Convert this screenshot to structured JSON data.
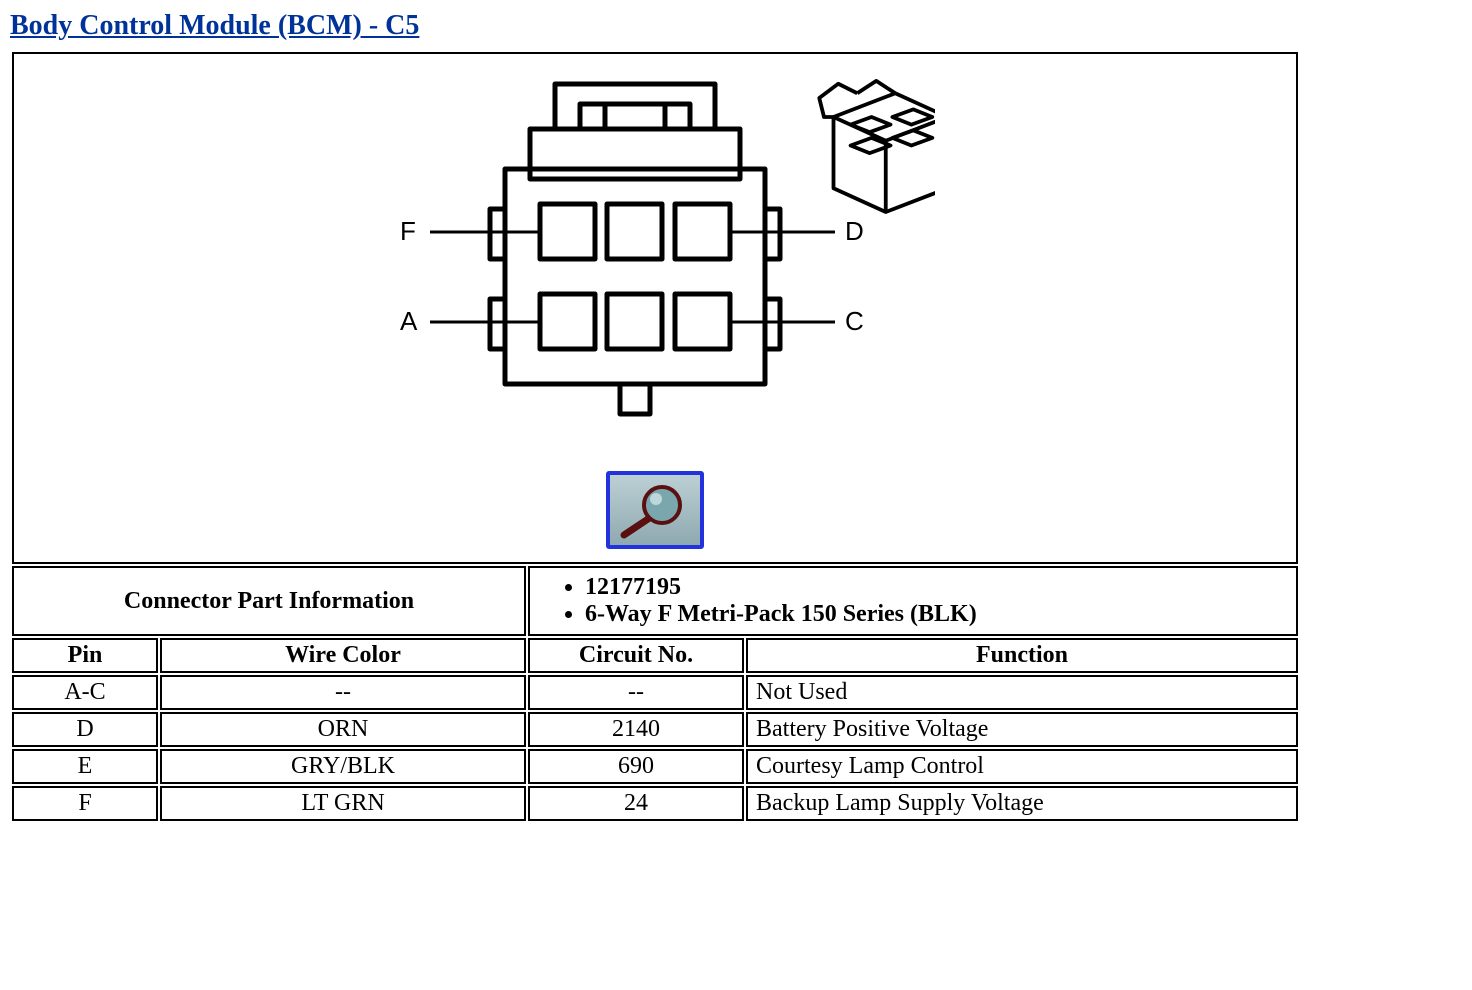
{
  "title": "Body Control Module (BCM) - C5",
  "pins_diagram": {
    "top_left": "F",
    "top_right": "D",
    "bottom_left": "A",
    "bottom_right": "C"
  },
  "cpi": {
    "label": "Connector Part Information",
    "part_no": "12177195",
    "desc": "6-Way F Metri-Pack 150 Series (BLK)"
  },
  "headers": {
    "pin": "Pin",
    "wire": "Wire Color",
    "circuit": "Circuit No.",
    "func": "Function"
  },
  "rows": [
    {
      "pin": "A-C",
      "wire": "--",
      "circuit": "--",
      "func": "Not Used"
    },
    {
      "pin": "D",
      "wire": "ORN",
      "circuit": "2140",
      "func": "Battery Positive Voltage"
    },
    {
      "pin": "E",
      "wire": "GRY/BLK",
      "circuit": "690",
      "func": "Courtesy Lamp Control"
    },
    {
      "pin": "F",
      "wire": "LT GRN",
      "circuit": "24",
      "func": "Backup Lamp Supply Voltage"
    }
  ]
}
